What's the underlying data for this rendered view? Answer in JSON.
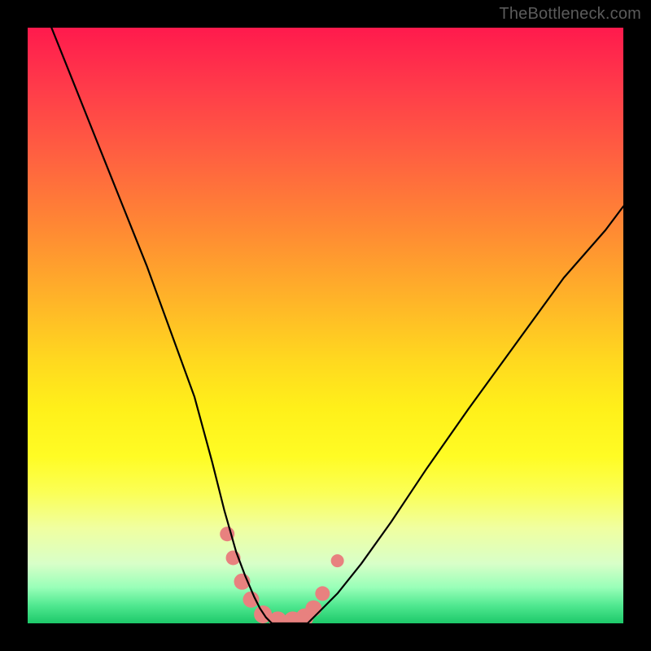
{
  "watermark": "TheBottleneck.com",
  "chart_data": {
    "type": "line",
    "title": "",
    "xlabel": "",
    "ylabel": "",
    "ylim": [
      0,
      100
    ],
    "xlim": [
      0,
      100
    ],
    "series": [
      {
        "name": "left-curve",
        "x": [
          4,
          8,
          12,
          16,
          20,
          24,
          28,
          31,
          33,
          35,
          36.5,
          38,
          39,
          40,
          41
        ],
        "y": [
          100,
          90,
          80,
          70,
          60,
          49,
          38,
          27,
          19,
          12,
          8,
          4.5,
          2.5,
          1,
          0
        ]
      },
      {
        "name": "right-curve",
        "x": [
          47,
          49,
          52,
          56,
          61,
          67,
          74,
          82,
          90,
          97,
          100
        ],
        "y": [
          0,
          2,
          5,
          10,
          17,
          26,
          36,
          47,
          58,
          66,
          70
        ]
      },
      {
        "name": "bottom-flat",
        "x": [
          41,
          47
        ],
        "y": [
          0,
          0
        ]
      }
    ],
    "markers": {
      "name": "highlight-dots",
      "color": "#e8817f",
      "points": [
        {
          "x": 33.5,
          "y": 15,
          "r": 9
        },
        {
          "x": 34.5,
          "y": 11,
          "r": 9
        },
        {
          "x": 36.0,
          "y": 7,
          "r": 10
        },
        {
          "x": 37.5,
          "y": 4,
          "r": 10
        },
        {
          "x": 39.5,
          "y": 1.5,
          "r": 11
        },
        {
          "x": 42.0,
          "y": 0.5,
          "r": 11
        },
        {
          "x": 44.5,
          "y": 0.5,
          "r": 11
        },
        {
          "x": 46.5,
          "y": 1.0,
          "r": 11
        },
        {
          "x": 48.0,
          "y": 2.5,
          "r": 10
        },
        {
          "x": 49.5,
          "y": 5.0,
          "r": 9
        },
        {
          "x": 52.0,
          "y": 10.5,
          "r": 8
        }
      ]
    },
    "background_gradient": {
      "top": "#ff1a4d",
      "mid": "#fff01a",
      "bottom": "#1dc96a"
    }
  }
}
